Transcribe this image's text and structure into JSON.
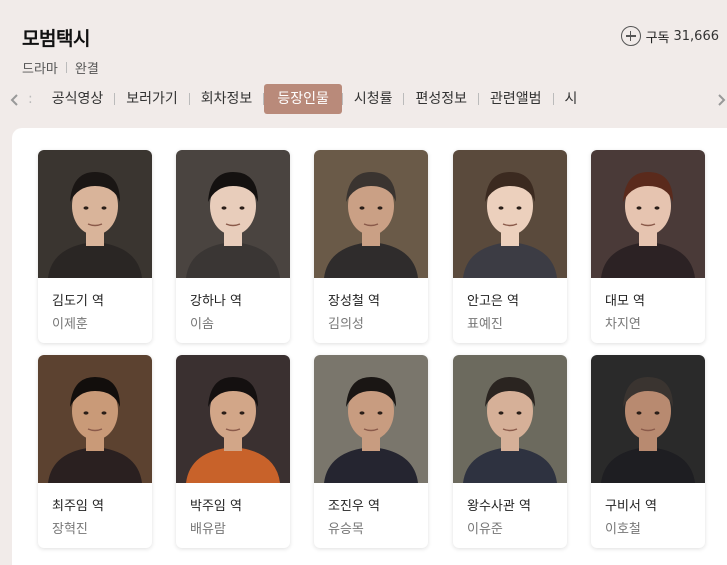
{
  "program": {
    "title": "모범택시",
    "genre": "드라마",
    "status": "완결",
    "subscribe_label": "구독",
    "subscribe_count": "31,666"
  },
  "tabs": [
    {
      "label": "공식영상"
    },
    {
      "label": "보러가기"
    },
    {
      "label": "회차정보"
    },
    {
      "label": "등장인물",
      "active": true
    },
    {
      "label": "시청률"
    },
    {
      "label": "편성정보"
    },
    {
      "label": "관련앨범"
    },
    {
      "label": "시"
    }
  ],
  "colors": {
    "page_bg": "#f1ebe9",
    "active_tab": "#b98a7a"
  },
  "cast": [
    {
      "role": "김도기 역",
      "actor": "이제훈"
    },
    {
      "role": "강하나 역",
      "actor": "이솜"
    },
    {
      "role": "장성철 역",
      "actor": "김의성"
    },
    {
      "role": "안고은 역",
      "actor": "표예진"
    },
    {
      "role": "대모 역",
      "actor": "차지연"
    },
    {
      "role": "최주임 역",
      "actor": "장혁진"
    },
    {
      "role": "박주임 역",
      "actor": "배유람"
    },
    {
      "role": "조진우 역",
      "actor": "유승목"
    },
    {
      "role": "왕수사관 역",
      "actor": "이유준"
    },
    {
      "role": "구비서 역",
      "actor": "이호철"
    }
  ]
}
